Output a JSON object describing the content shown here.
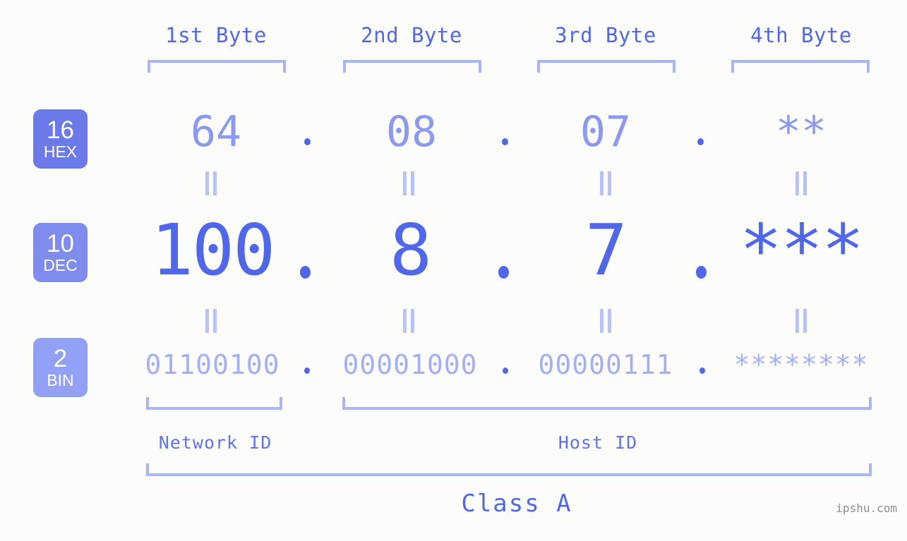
{
  "background_color": "#fcfdfa",
  "palette": {
    "accent_dark": "#4f67e8",
    "accent_mid": "#8b99ee",
    "accent_light": "#a3b0f7",
    "bracket": "#aab5f7",
    "badge_hex": "#6b7ae8",
    "badge_dec": "#7f8cee",
    "badge_bin": "#92a0f5",
    "watermark": "#8e8e8e"
  },
  "headers": [
    {
      "label": "1st Byte"
    },
    {
      "label": "2nd Byte"
    },
    {
      "label": "3rd Byte"
    },
    {
      "label": "4th Byte"
    }
  ],
  "bases": [
    {
      "num": "16",
      "abbr": "HEX"
    },
    {
      "num": "10",
      "abbr": "DEC"
    },
    {
      "num": "2",
      "abbr": "BIN"
    }
  ],
  "rows": {
    "hex": {
      "base": "16",
      "name": "HEX",
      "values": [
        "64",
        "08",
        "07",
        "**"
      ]
    },
    "dec": {
      "base": "10",
      "name": "DEC",
      "values": [
        "100",
        "8",
        "7",
        "***"
      ]
    },
    "bin": {
      "base": "2",
      "name": "BIN",
      "values": [
        "01100100",
        "00001000",
        "00000111",
        "********"
      ]
    }
  },
  "separator": ".",
  "equals_mark": "=",
  "segments": {
    "network_id": "Network ID",
    "host_id": "Host ID",
    "class": "Class A"
  },
  "watermark": "ipshu.com"
}
